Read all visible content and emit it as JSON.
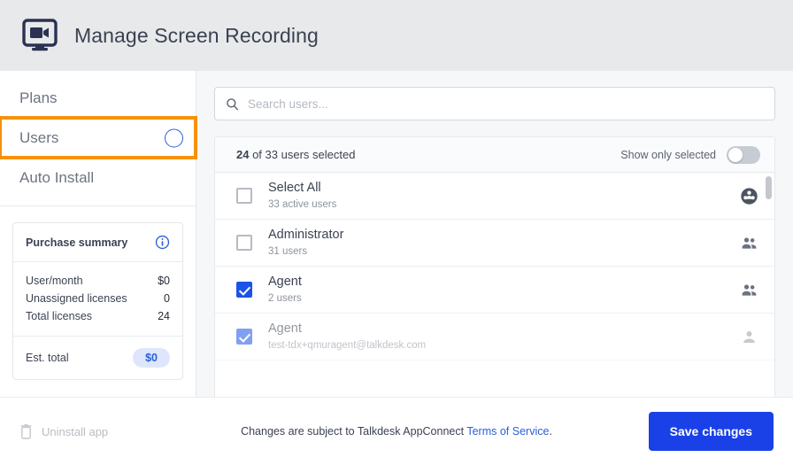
{
  "header": {
    "title": "Manage Screen Recording",
    "icon": "screen-recording-icon"
  },
  "sidebar": {
    "items": [
      {
        "label": "Plans",
        "active": false
      },
      {
        "label": "Users",
        "active": true
      },
      {
        "label": "Auto Install",
        "active": false
      }
    ],
    "purchase_summary": {
      "title": "Purchase summary",
      "info_icon": "info-circle-icon",
      "rows": [
        {
          "label": "User/month",
          "value": "$0"
        },
        {
          "label": "Unassigned licenses",
          "value": "0"
        },
        {
          "label": "Total licenses",
          "value": "24"
        }
      ],
      "total_label": "Est. total",
      "total_value": "$0"
    }
  },
  "main": {
    "search": {
      "placeholder": "Search users...",
      "value": "",
      "icon": "search-icon"
    },
    "list_header": {
      "selected_count": "24",
      "selected_text": " of 33 users selected",
      "toggle_label": "Show only selected",
      "toggle_on": false
    },
    "rows": [
      {
        "title": "Select All",
        "subtitle": "33 active users",
        "checked": false,
        "icon": "group-circle-icon"
      },
      {
        "title": "Administrator",
        "subtitle": "31 users",
        "checked": false,
        "icon": "people-icon"
      },
      {
        "title": "Agent",
        "subtitle": "2 users",
        "checked": true,
        "icon": "people-icon"
      },
      {
        "title": "Agent",
        "subtitle": "test-tdx+qmuragent@talkdesk.com",
        "checked": true,
        "icon": "person-icon"
      }
    ]
  },
  "footer": {
    "uninstall_label": "Uninstall app",
    "uninstall_icon": "trash-icon",
    "note_prefix": "Changes are subject to Talkdesk AppConnect ",
    "note_link": "Terms of Service",
    "note_suffix": ".",
    "save_label": "Save changes"
  },
  "colors": {
    "accent_blue": "#1a41e8",
    "checkbox_blue": "#1a53e8",
    "link_blue": "#2b5fd9",
    "highlight_orange": "#f5920b",
    "header_bg": "#e8e9eb",
    "badge_bg": "#dde6fb"
  }
}
